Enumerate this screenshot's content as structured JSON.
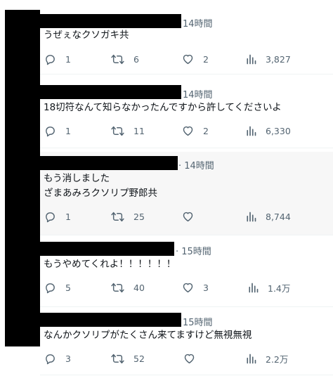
{
  "tweets": [
    {
      "time": "14時間",
      "lines": [
        "うぜぇなクソガキ共",
        ""
      ],
      "replies": "1",
      "retweets": "6",
      "likes": "2",
      "views": "3,827"
    },
    {
      "time": "14時間",
      "lines": [
        "18切符なんて知らなかったんですから許してくださいよ",
        ""
      ],
      "replies": "1",
      "retweets": "11",
      "likes": "2",
      "views": "6,330"
    },
    {
      "time": "· 14時間",
      "lines": [
        "もう消しました",
        "ざまあみろクソリプ野郎共"
      ],
      "replies": "1",
      "retweets": "25",
      "likes": "",
      "views": "8,744"
    },
    {
      "time": "· 15時間",
      "lines": [
        "もうやめてくれよ！！！！！！",
        ""
      ],
      "replies": "5",
      "retweets": "40",
      "likes": "3",
      "views": "1.4万"
    },
    {
      "time": "15時間",
      "lines": [
        "なんかクソリプがたくさん来てますけど無視無視",
        ""
      ],
      "replies": "3",
      "retweets": "52",
      "likes": "",
      "views": "2.2万"
    }
  ],
  "icons": {
    "reply": "reply-icon",
    "retweet": "retweet-icon",
    "like": "heart-icon",
    "views": "views-icon",
    "share": "share-icon"
  },
  "colors": {
    "text": "#0f1419",
    "muted": "#536471",
    "redaction": "#000000",
    "shaded_row": "#f7f7f7"
  }
}
